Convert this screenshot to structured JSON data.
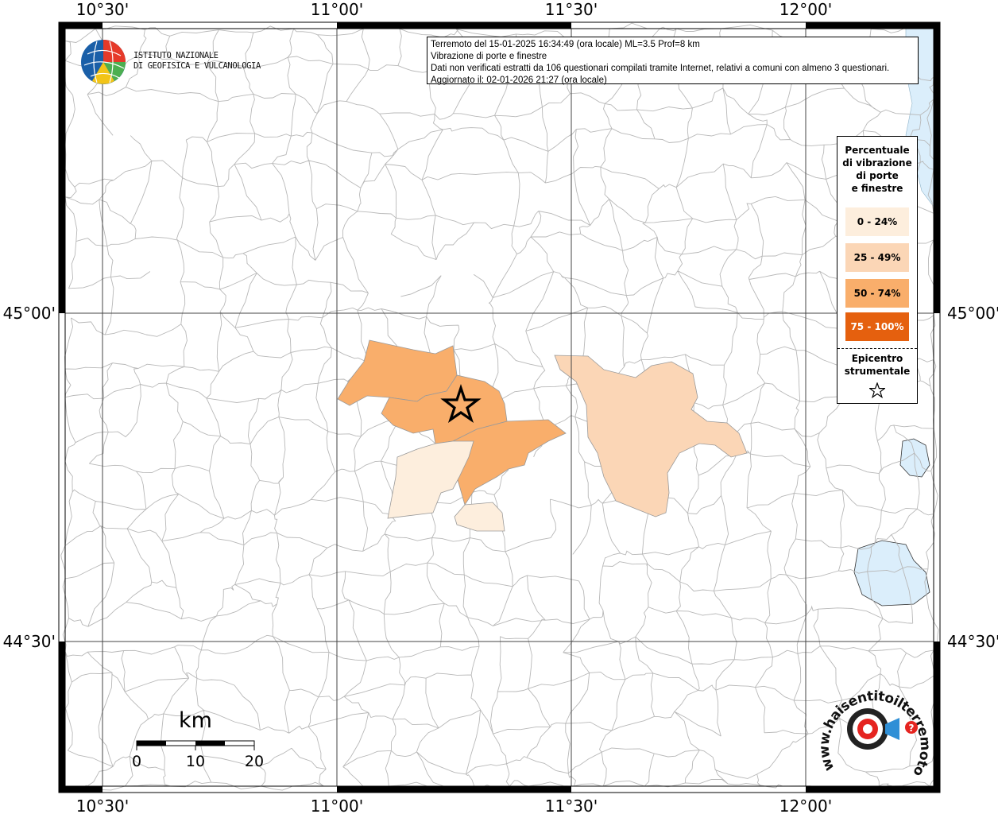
{
  "map": {
    "lon_labels": [
      "10°30'",
      "11°00'",
      "11°30'",
      "12°00'"
    ],
    "lat_labels": [
      "45°00'",
      "44°30'"
    ],
    "colors": {
      "water": "#dbeefb",
      "boundary": "#b8b8b8",
      "grid": "#444444",
      "class_0_24": "#fdeedd",
      "class_25_49": "#fbd6b6",
      "class_50_74": "#f9ae6b",
      "class_75_100": "#e5600e"
    }
  },
  "info": {
    "line1": "Terremoto del 15-01-2025 16:34:49 (ora locale) ML=3.5 Prof=8 km",
    "line2": "Vibrazione di porte e finestre",
    "line3": "Dati non verificati estratti da 106 questionari compilati tramite Internet, relativi a comuni con almeno 3 questionari.",
    "line4": "Aggiornato il: 02-01-2026 21:27 (ora locale)"
  },
  "legend": {
    "title_line1": "Percentuale",
    "title_line2": "di vibrazione",
    "title_line3": "di porte",
    "title_line4": "e finestre",
    "items": [
      {
        "label": "0 - 24%",
        "color": "#fdeedd",
        "text_color": "#000000"
      },
      {
        "label": "25 - 49%",
        "color": "#fbd6b6",
        "text_color": "#000000"
      },
      {
        "label": "50 - 74%",
        "color": "#f9ae6b",
        "text_color": "#000000"
      },
      {
        "label": "75 - 100%",
        "color": "#e5600e",
        "text_color": "#ffffff"
      }
    ],
    "epicenter_line1": "Epicentro",
    "epicenter_line2": "strumentale",
    "epicenter_icon": "star-outline-icon"
  },
  "scale_bar": {
    "unit": "km",
    "ticks": [
      "0",
      "10",
      "20"
    ]
  },
  "logos": {
    "ingv_line1": "ISTITUTO NAZIONALE",
    "ingv_line2": "DI GEOFISICA E VULCANOLOGIA",
    "hst_text": "www.haisentitoilterremoto.it",
    "hst_question": "?"
  }
}
